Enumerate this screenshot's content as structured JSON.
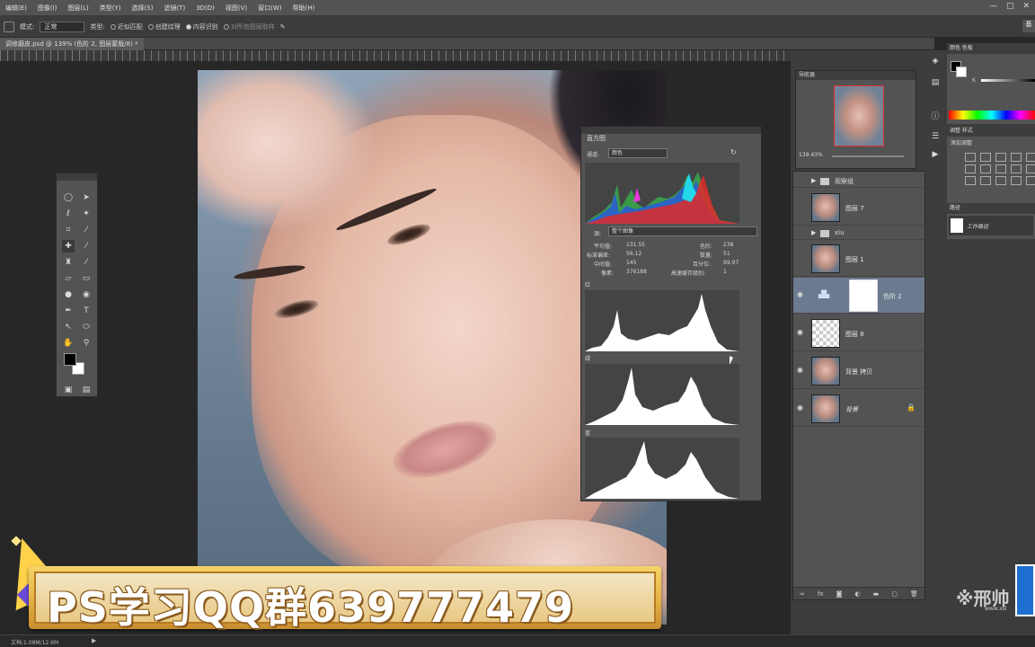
{
  "menubar": {
    "items": [
      "编辑(E)",
      "图像(I)",
      "图层(L)",
      "类型(Y)",
      "选择(S)",
      "滤镜(T)",
      "3D(D)",
      "视图(V)",
      "窗口(W)",
      "帮助(H)"
    ]
  },
  "options": {
    "mode_label": "模式:",
    "mode_value": "正常",
    "type_label": "类型:",
    "opt1": "近似匹配",
    "opt2": "创建纹理",
    "opt3": "内容识别",
    "opt4": "对所有图层取样",
    "right_btn": "基"
  },
  "document": {
    "tab_title": "调修磨皮.psd @ 139% (色阶 2, 图层蒙版/8) *"
  },
  "histogram": {
    "title": "直方图",
    "channel_label": "通道:",
    "channel_value": "颜色",
    "source_label": "源:",
    "source_value": "整个图像",
    "stats": {
      "mean_label": "平均值:",
      "mean": "131.55",
      "std_label": "标准偏差:",
      "std": "56.12",
      "median_label": "中间值:",
      "median": "145",
      "pixels_label": "像素:",
      "pixels": "376188",
      "level_label": "色阶:",
      "level": "238",
      "count_label": "数量:",
      "count": "51",
      "percentile_label": "百分位:",
      "percentile": "99.97",
      "cache_label": "高速缓存级别:",
      "cache": "1"
    },
    "red_label": "红",
    "green_label": "绿",
    "blue_label": "蓝"
  },
  "navigator": {
    "title": "导航器",
    "zoom": "139.43%"
  },
  "layers": {
    "group1": "观察组",
    "layer7": "图层 7",
    "group2": "xiu",
    "layer1": "图层 1",
    "adjust": "色阶 2",
    "layer8": "图层 8",
    "bgcopy": "背景 拷贝",
    "bg": "背景"
  },
  "colorpanel": {
    "tabs": "颜色   色板",
    "k": "K"
  },
  "adjpanel": {
    "tabs": "调整   样式",
    "title": "添加调整"
  },
  "paths": {
    "tab": "路径",
    "item": "工作路径"
  },
  "status": {
    "text": "文档:1.08M/12.6M"
  },
  "banner": {
    "text": "PS学习QQ群639777479"
  },
  "watermark": {
    "text": "邢帅",
    "sub": "www.xsl"
  }
}
